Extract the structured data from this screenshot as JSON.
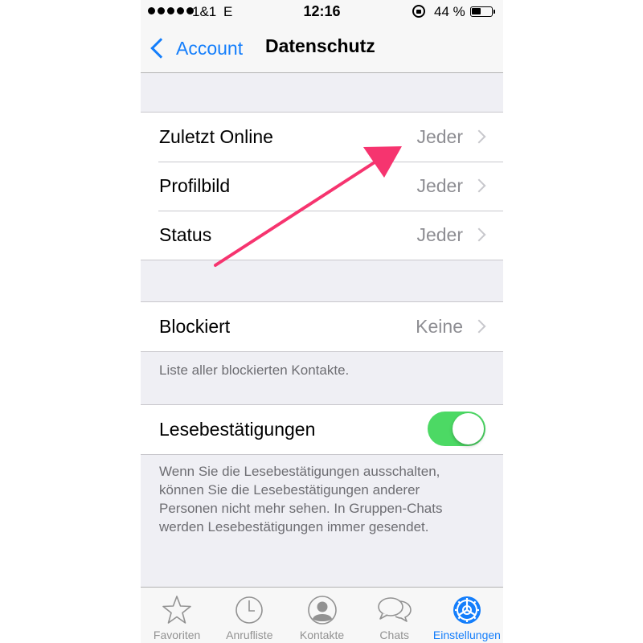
{
  "status_bar": {
    "carrier": "1&1",
    "network": "E",
    "time": "12:16",
    "battery_percent": "44 %",
    "battery_level": 0.44
  },
  "nav": {
    "back_label": "Account",
    "title": "Datenschutz"
  },
  "privacy_group": [
    {
      "label": "Zuletzt Online",
      "value": "Jeder"
    },
    {
      "label": "Profilbild",
      "value": "Jeder"
    },
    {
      "label": "Status",
      "value": "Jeder"
    }
  ],
  "blocked": {
    "label": "Blockiert",
    "value": "Keine",
    "footer": "Liste aller blockierten Kontakte."
  },
  "read_receipts": {
    "label": "Lesebestätigungen",
    "enabled": true,
    "footer": "Wenn Sie die Lesebestätigungen ausschalten, können Sie die Lesebestätigungen anderer Personen nicht mehr sehen. In Gruppen-Chats werden Lesebestätigungen immer gesendet."
  },
  "tabs": [
    {
      "label": "Favoriten",
      "icon": "star-icon",
      "active": false
    },
    {
      "label": "Anrufliste",
      "icon": "clock-icon",
      "active": false
    },
    {
      "label": "Kontakte",
      "icon": "person-icon",
      "active": false
    },
    {
      "label": "Chats",
      "icon": "chat-bubbles-icon",
      "active": false
    },
    {
      "label": "Einstellungen",
      "icon": "gear-icon",
      "active": true
    }
  ],
  "colors": {
    "accent": "#147efb",
    "toggle_on": "#4cd964",
    "annotation_arrow": "#f6346f"
  }
}
